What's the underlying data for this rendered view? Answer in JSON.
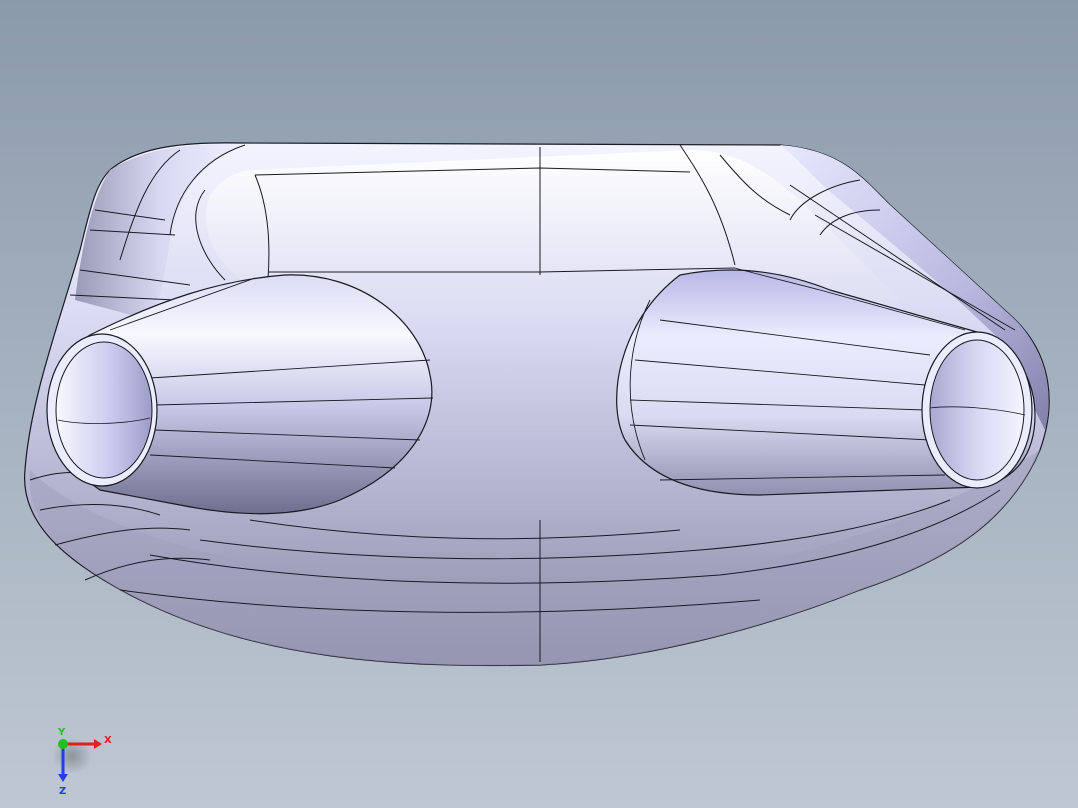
{
  "viewport": {
    "model": "cad-part-hollow-body-with-two-tapered-nozzles",
    "render_style": "shaded-with-edges"
  },
  "colors": {
    "background_top": "#8b9aab",
    "background_bottom": "#bfc7d2",
    "part_face": "#e7e7f9",
    "part_shadow": "#8c8caa",
    "edge": "#1a1a22",
    "axis_x": "#e02020",
    "axis_y": "#20c020",
    "axis_z": "#2040e0"
  },
  "triad": {
    "x_label": "X",
    "y_label": "Y",
    "z_label": "Z"
  }
}
